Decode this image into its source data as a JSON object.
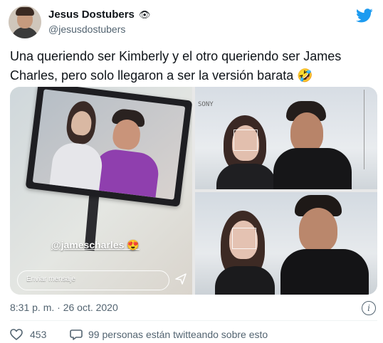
{
  "author": {
    "display_name": "Jesus Dostubers",
    "emoji": "👁",
    "handle": "@jesusdostubers"
  },
  "tweet": {
    "text_line1": "Una queriendo ser Kimberly y el otro queriendo ser James",
    "text_line2": "Charles, pero solo llegaron a ser la versión barata 🤣"
  },
  "media": {
    "tag": "@jamescharles 😍",
    "message_placeholder": "Enviar mensaje",
    "hud_label": "SONY"
  },
  "meta": {
    "timestamp": "8:31 p. m. · 26 oct. 2020"
  },
  "actions": {
    "likes": "453",
    "talking": "99 personas están twitteando sobre esto"
  },
  "icons": {
    "twitter": "twitter-bird-icon",
    "info": "info-icon",
    "like": "heart-icon",
    "reply": "speech-bubble-icon",
    "send": "send-icon"
  },
  "colors": {
    "twitter_blue": "#1d9bf0",
    "secondary_text": "#536471",
    "primary_text": "#0f1419"
  }
}
